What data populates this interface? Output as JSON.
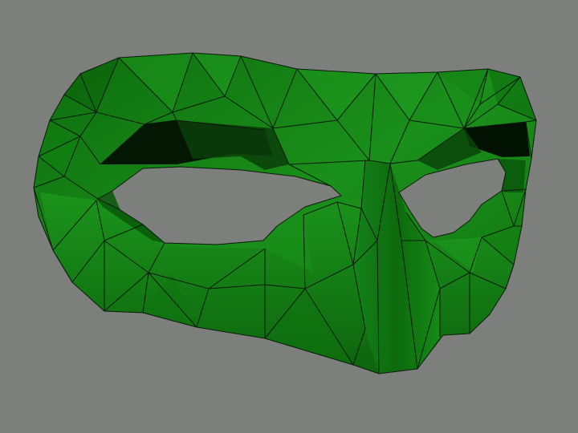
{
  "scene": {
    "subject": "low-poly-eye-mask",
    "render_mode": "flat-shaded-wireframe",
    "colors": {
      "background": "#7d7f7c",
      "mask_dark": "#0a5e0a",
      "mask_mid": "#127a12",
      "mask_light": "#1f9a1f",
      "interior_shadow": "#031703",
      "edge_lines": "#0b1a0b"
    }
  }
}
